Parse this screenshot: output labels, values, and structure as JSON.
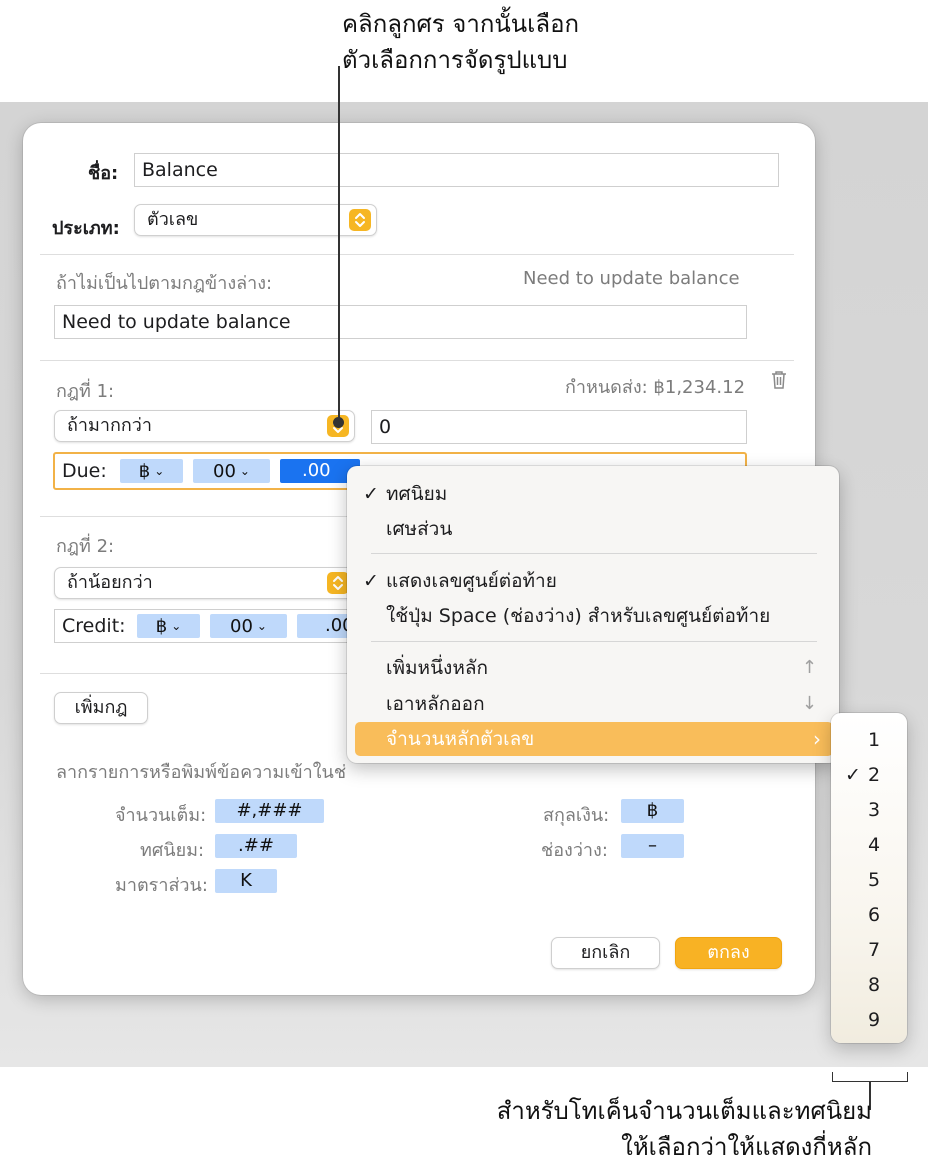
{
  "callouts": {
    "top_line1": "คลิกลูกศร จากนั้นเลือก",
    "top_line2": "ตัวเลือกการจัดรูปแบบ",
    "bottom_line1": "สำหรับโทเค็นจำนวนเต็มและทศนิยม",
    "bottom_line2": "ให้เลือกว่าให้แสดงกี่หลัก"
  },
  "dialog": {
    "name_label": "ชื่อ:",
    "name_value": "Balance",
    "type_label": "ประเภท:",
    "type_value": "ตัวเลข",
    "default_label": "ถ้าไม่เป็นไปตามกฎข้างล่าง:",
    "default_preview": "Need to update balance",
    "default_value": "Need to update balance",
    "rule1": {
      "label": "กฎที่ 1:",
      "preview": "กำหนดส่ง: ฿1,234.12",
      "condition": "ถ้ามากกว่า",
      "value": "0",
      "format_label": "Due:",
      "tokens": [
        "฿",
        "00",
        ".00"
      ]
    },
    "rule2": {
      "label": "กฎที่ 2:",
      "condition": "ถ้าน้อยกว่า",
      "format_label": "Credit:",
      "tokens": [
        "฿",
        "00",
        ".00"
      ]
    },
    "add_rule_button": "เพิ่มกฎ",
    "drag_hint": "ลากรายการหรือพิมพ์ข้อความเข้าในช่องข้างบน:",
    "palette": {
      "integer_label": "จำนวนเต็ม:",
      "integer_token": "#,###",
      "decimal_label": "ทศนิยม:",
      "decimal_token": ".##",
      "scale_label": "มาตราส่วน:",
      "scale_token": "K",
      "currency_label": "สกุลเงิน:",
      "currency_token": "฿",
      "space_label": "ช่องว่าง:",
      "space_token": "–"
    },
    "cancel_button": "ยกเลิก",
    "ok_button": "ตกลง"
  },
  "menu": {
    "decimal": "ทศนิยม",
    "fraction": "เศษส่วน",
    "show_trailing_zeros": "แสดงเลขศูนย์ต่อท้าย",
    "use_space_trailing": "ใช้ปุ่ม Space (ช่องว่าง) สำหรับเลขศูนย์ต่อท้าย",
    "add_digit": "เพิ่มหนึ่งหลัก",
    "add_digit_shortcut": "↑",
    "remove_digit": "เอาหลักออก",
    "remove_digit_shortcut": "↓",
    "digit_count": "จำนวนหลักตัวเลข",
    "submenu_arrow": "›",
    "checkmark": "✓"
  },
  "submenu": {
    "options": [
      "1",
      "2",
      "3",
      "4",
      "5",
      "6",
      "7",
      "8",
      "9"
    ],
    "selected": "2"
  },
  "colors": {
    "accent": "#f8b224",
    "token": "#bfd9fb",
    "token_selected": "#1a73f0",
    "highlight": "#f9bd5a"
  }
}
